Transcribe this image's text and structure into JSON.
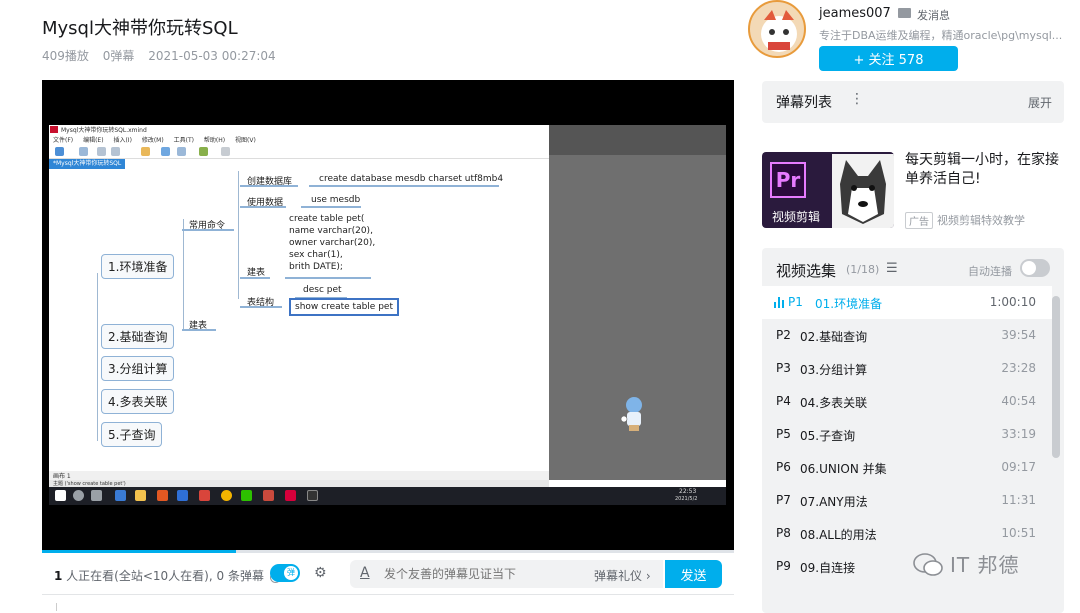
{
  "video": {
    "title": "Mysql大神带你玩转SQL",
    "plays": "409播放",
    "danmaku_count": "0弹幕",
    "date": "2021-05-03 00:27:04"
  },
  "screen": {
    "app_title": "Mysql大神带你玩转SQL.xmind",
    "menu": [
      "文件(F)",
      "编辑(E)",
      "插入(I)",
      "修改(M)",
      "工具(T)",
      "帮助(H)",
      "视图(V)"
    ],
    "doc_tab": "*Mysql大神带你玩转SQL",
    "nodes": {
      "n1": "1.环境准备",
      "n2": "2.基础查询",
      "n3": "3.分组计算",
      "n4": "4.多表关联",
      "n5": "5.子查询",
      "common_cmd": "常用命令",
      "build_table": "建表",
      "create_db": "创建数据库",
      "create_db_cmd": "create database mesdb charset utf8mb4",
      "use_db": "使用数据",
      "use_db_cmd": "use mesdb",
      "jianbiao": "建表",
      "create_table_cmd": "create table pet(\nname varchar(20),\nowner varchar(20),\nsex char(1),\nbrith DATE);",
      "table_struct": "表结构",
      "desc_cmd": "desc pet",
      "show_cmd": "show create table pet"
    },
    "status_line": "画布 1",
    "status_line2": "主题 ('show create table pet')",
    "tray_time": "22:53",
    "tray_date": "2021/5/2"
  },
  "controls": {
    "viewers_count": "1",
    "viewers_text": " 人正在看(全站<10人在看), 0 条弹幕",
    "danmaku_toggle_label": "弹",
    "input_placeholder": "发个友善的弹幕见证当下",
    "etiquette": "弹幕礼仪 ›",
    "send": "发送"
  },
  "uploader": {
    "name": "jeames007",
    "message_link": "发消息",
    "bio": "专注于DBA运维及编程，精通oracle\\pg\\mysql...",
    "follow_label": "+  关注 578"
  },
  "danmaku_list": {
    "title": "弹幕列表",
    "more": "⋮",
    "expand": "展开"
  },
  "ad": {
    "logo_text": "Pr",
    "caption": "视频剪辑",
    "title": "每天剪辑一小时，在家接单养活自己!",
    "tag": "广告",
    "desc": "视频剪辑特效教学"
  },
  "playlist": {
    "title": "视频选集",
    "count": "(1/18)",
    "autoplay_label": "自动连播",
    "items": [
      {
        "p": "P1",
        "name": "01.环境准备",
        "dur": "1:00:10"
      },
      {
        "p": "P2",
        "name": "02.基础查询",
        "dur": "39:54"
      },
      {
        "p": "P3",
        "name": "03.分组计算",
        "dur": "23:28"
      },
      {
        "p": "P4",
        "name": "04.多表关联",
        "dur": "40:54"
      },
      {
        "p": "P5",
        "name": "05.子查询",
        "dur": "33:19"
      },
      {
        "p": "P6",
        "name": "06.UNION 并集",
        "dur": "09:17"
      },
      {
        "p": "P7",
        "name": "07.ANY用法",
        "dur": "11:31"
      },
      {
        "p": "P8",
        "name": "08.ALL的用法",
        "dur": "10:51"
      },
      {
        "p": "P9",
        "name": "09.自连接",
        "dur": ""
      }
    ]
  },
  "watermark": "IT 邦德",
  "colors": {
    "accent": "#00aeec",
    "text": "#18191c",
    "muted": "#9499a0"
  }
}
